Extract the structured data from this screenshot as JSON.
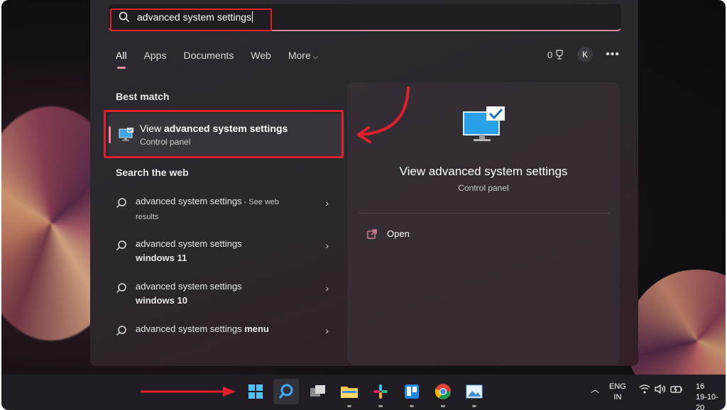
{
  "search": {
    "query": "advanced system settings"
  },
  "tabs": [
    {
      "label": "All"
    },
    {
      "label": "Apps"
    },
    {
      "label": "Documents"
    },
    {
      "label": "Web"
    },
    {
      "label": "More"
    }
  ],
  "header_right": {
    "points": "0",
    "avatar_initial": "K"
  },
  "best_match": {
    "section": "Best match",
    "title_prefix": "View ",
    "title_bold": "advanced system settings",
    "subtitle": "Control panel"
  },
  "web": {
    "section": "Search the web",
    "items": [
      {
        "line1": "advanced system settings",
        "suffix": " - See web",
        "line2": "results"
      },
      {
        "line1": "advanced system settings",
        "line2_bold": "windows 11"
      },
      {
        "line1": "advanced system settings",
        "line2_bold": "windows 10"
      },
      {
        "line1": "advanced system settings ",
        "bold_tail": "menu"
      }
    ]
  },
  "detail": {
    "title": "View advanced system settings",
    "subtitle": "Control panel",
    "open_label": "Open"
  },
  "tray": {
    "lang1": "ENG",
    "lang2": "IN",
    "time": "16",
    "date": "19-10-20"
  },
  "colors": {
    "accent": "#f08aa0",
    "annotation_red": "#e0202a",
    "panel": "#2c2a31"
  }
}
